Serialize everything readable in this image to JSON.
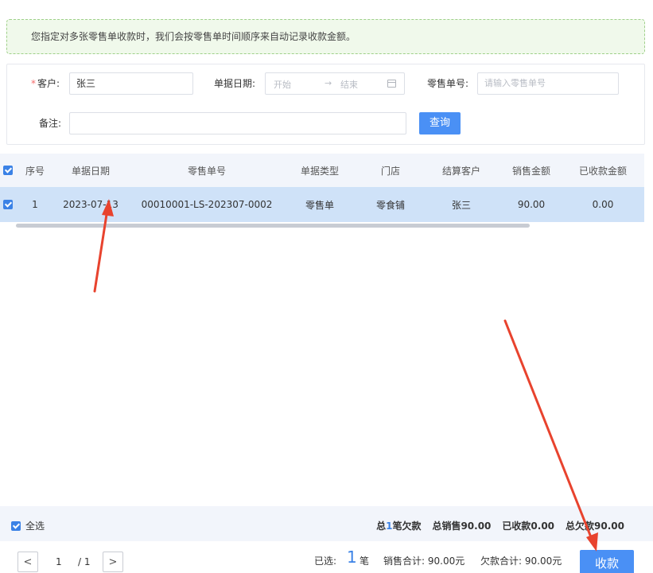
{
  "notice": "您指定对多张零售单收款时，我们会按零售单时间顺序来自动记录收款金额。",
  "filter": {
    "customer_label": "客户:",
    "customer_value": "张三",
    "date_label": "单据日期:",
    "date_start": "开始",
    "date_arrow": "→",
    "date_end": "结束",
    "order_label": "零售单号:",
    "order_placeholder": "请输入零售单号",
    "remark_label": "备注:",
    "query_button": "查询"
  },
  "table": {
    "columns": [
      "序号",
      "单据日期",
      "零售单号",
      "单据类型",
      "门店",
      "结算客户",
      "销售金额",
      "已收款金额"
    ],
    "rows": [
      [
        "1",
        "2023-07-13",
        "00010001-LS-202307-0002",
        "零售单",
        "零食铺",
        "张三",
        "90.00",
        "0.00"
      ]
    ]
  },
  "footer": {
    "select_all": "全选",
    "total_prefix": "总",
    "total_count": "1",
    "total_suffix": "笔欠款",
    "total_sales": "总销售90.00",
    "received": "已收款0.00",
    "total_owed": "总欠款90.00"
  },
  "pagination": {
    "prev": "<",
    "current": "1",
    "total": "/ 1",
    "next": ">"
  },
  "selection": {
    "selected_label": "已选:",
    "selected_count": "1",
    "unit": "笔",
    "sales_total": "销售合计: 90.00元",
    "owed_total": "欠款合计: 90.00元"
  },
  "pay_button": "收款",
  "colors": {
    "primary": "#4a90f5",
    "selected_row": "#cfe2f8",
    "annotation_arrow": "#e8432e"
  }
}
